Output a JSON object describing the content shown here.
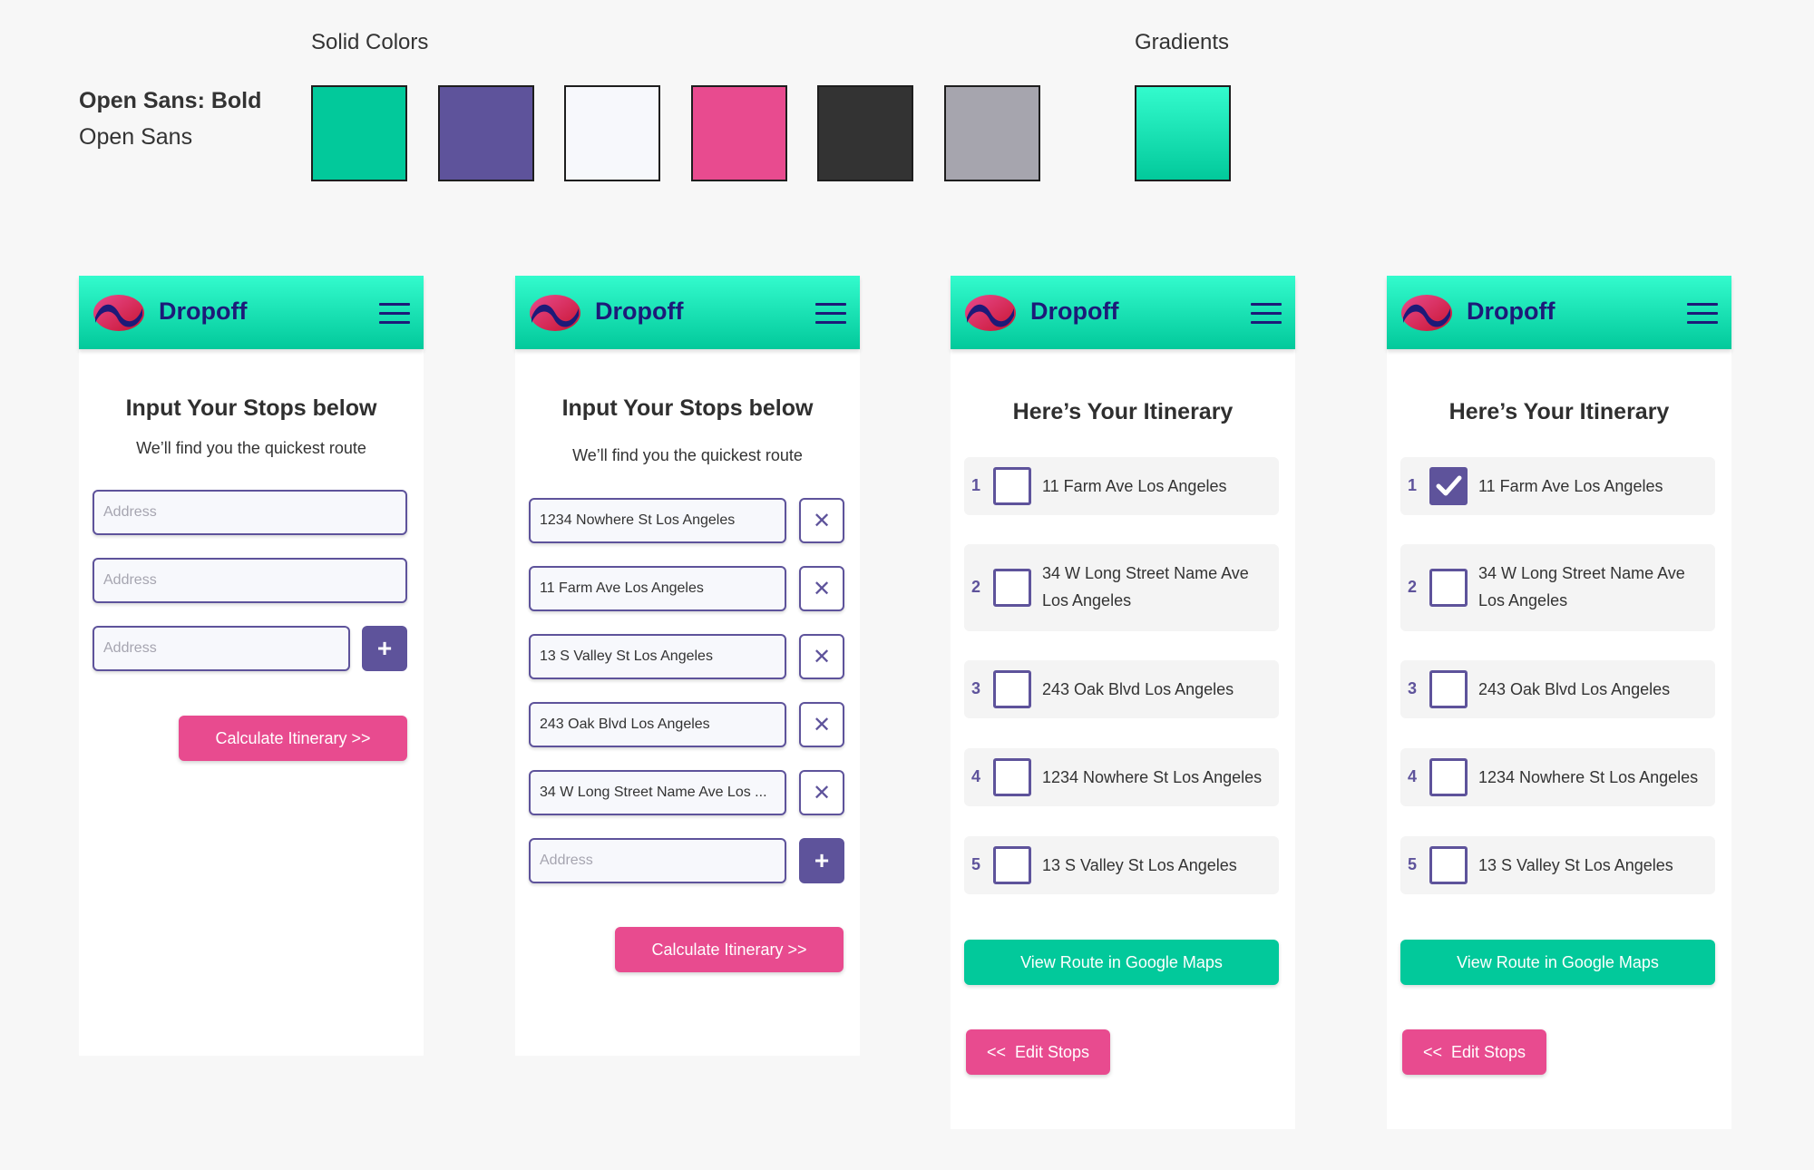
{
  "style_guide": {
    "solid_colors_heading": "Solid Colors",
    "gradients_heading": "Gradients",
    "font_bold_label": "Open Sans: Bold",
    "font_regular_label": "Open Sans",
    "solid_colors": [
      "#02c99b",
      "#5e539b",
      "#f7f8fc",
      "#e84b8f",
      "#333333",
      "#a6a5ae"
    ],
    "gradient": {
      "from": "#33fbcd",
      "to": "#02c99b"
    }
  },
  "brand": {
    "name": "Dropoff"
  },
  "screens": {
    "input_empty": {
      "title": "Input Your Stops below",
      "subtitle": "We’ll find you the quickest route",
      "inputs": [
        {
          "value": "",
          "placeholder": "Address"
        },
        {
          "value": "",
          "placeholder": "Address"
        },
        {
          "value": "",
          "placeholder": "Address"
        }
      ],
      "add_label": "+",
      "calculate_label": "Calculate Itinerary >>"
    },
    "input_filled": {
      "title": "Input Your Stops below",
      "subtitle": "We’ll find you the quickest route",
      "inputs": [
        {
          "value": "1234 Nowhere St Los Angeles"
        },
        {
          "value": "11 Farm Ave Los Angeles"
        },
        {
          "value": "13 S Valley St Los Angeles"
        },
        {
          "value": "243 Oak Blvd Los Angeles"
        },
        {
          "value": "34 W Long Street Name Ave Los ..."
        },
        {
          "value": "",
          "placeholder": "Address"
        }
      ],
      "remove_label": "✕",
      "add_label": "+",
      "calculate_label": "Calculate Itinerary >>"
    },
    "itinerary": {
      "title": "Here’s Your Itinerary",
      "stops": [
        {
          "num": "1",
          "address": "11 Farm Ave Los Angeles",
          "checked": false
        },
        {
          "num": "2",
          "address": "34 W Long Street Name Ave Los Angeles",
          "checked": false
        },
        {
          "num": "3",
          "address": "243 Oak Blvd Los Angeles",
          "checked": false
        },
        {
          "num": "4",
          "address": "1234 Nowhere St Los Angeles",
          "checked": false
        },
        {
          "num": "5",
          "address": "13 S Valley St Los Angeles",
          "checked": false
        }
      ],
      "maps_label": "View Route in Google Maps",
      "edit_label": "<<  Edit Stops"
    },
    "itinerary_checked": {
      "title": "Here’s Your Itinerary",
      "stops": [
        {
          "num": "1",
          "address": "11 Farm Ave Los Angeles",
          "checked": true
        },
        {
          "num": "2",
          "address": "34 W Long Street Name Ave Los Angeles",
          "checked": false
        },
        {
          "num": "3",
          "address": "243 Oak Blvd Los Angeles",
          "checked": false
        },
        {
          "num": "4",
          "address": "1234 Nowhere St Los Angeles",
          "checked": false
        },
        {
          "num": "5",
          "address": "13 S Valley St Los Angeles",
          "checked": false
        }
      ],
      "maps_label": "View Route in Google Maps",
      "edit_label": "<<  Edit Stops"
    }
  }
}
